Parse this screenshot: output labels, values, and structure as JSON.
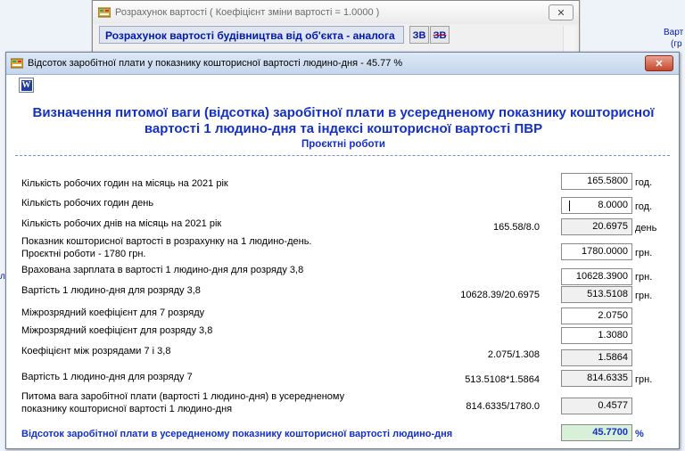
{
  "background_window": {
    "title": "Розрахунок вартості ( Коефіцієнт зміни вартості = 1.0000 )",
    "header": "Розрахунок вартості будівництва від об'єкта - аналога",
    "btn1": "ЗВ",
    "btn2": "ЗВ",
    "close": "✕",
    "right_text_1": "Варт",
    "right_text_2": "(гр",
    "left_text": "ля"
  },
  "dialog": {
    "title": "Відсоток заробітної плати у показнику кошторисної вартості людино-дня - 45.77 %",
    "close": "✕",
    "word_icon": "W",
    "heading_line1": "Визначення питомої ваги (відсотка) заробітної плати в усередненому показнику кошторисної",
    "heading_line2": "вартості 1 людино-дня та індексі кошторисної вартості ПВР",
    "subtitle": "Проєктні роботи",
    "rows": [
      {
        "label": "Кількість робочих годин на місяць на 2021 рік",
        "calc": "",
        "value": "165.5800",
        "unit": "год."
      },
      {
        "label": "Кількість робочих годин день",
        "calc": "",
        "value": "8.0000",
        "unit": "год."
      },
      {
        "label": "Кількість робочих днів на місяць на 2021 рік",
        "calc": "165.58/8.0",
        "value": "20.6975",
        "unit": "день"
      },
      {
        "label": "Показник кошторисної вартості в розрахунку на 1 людино-день.",
        "label2": "Проєктні роботи - 1780 грн.",
        "calc": "",
        "value": "1780.0000",
        "unit": "грн."
      },
      {
        "label": "Врахована зарплата в вартості 1 людино-дня для розряду 3,8",
        "calc": "",
        "value": "10628.3900",
        "unit": "грн."
      },
      {
        "label": "Вартість 1 людино-дня для розряду 3,8",
        "calc": "10628.39/20.6975",
        "value": "513.5108",
        "unit": "грн."
      },
      {
        "label": "Міжрозрядний коефіцієнт для 7 розряду",
        "calc": "",
        "value": "2.0750",
        "unit": ""
      },
      {
        "label": "Міжрозрядний коефіцієнт для  розряду 3,8",
        "calc": "",
        "value": "1.3080",
        "unit": ""
      },
      {
        "label": "Коефіцієнт між розрядами 7 і 3,8",
        "calc": "2.075/1.308",
        "value": "1.5864",
        "unit": ""
      },
      {
        "label": "Вартість 1 людино-дня для розряду 7",
        "calc": "513.5108*1.5864",
        "value": "814.6335",
        "unit": "грн."
      },
      {
        "label": "Питома вага заробітної плати (вартості 1 людино-дня) в усередненому",
        "label2": "показнику кошторисної вартості 1 людино-дня",
        "calc": "814.6335/1780.0",
        "value": "0.4577",
        "unit": ""
      },
      {
        "label": "Відсоток заробітної плати в усередненому показнику кошторисної вартості людино-дня",
        "calc": "",
        "value": "45.7700",
        "unit": "%"
      }
    ]
  }
}
